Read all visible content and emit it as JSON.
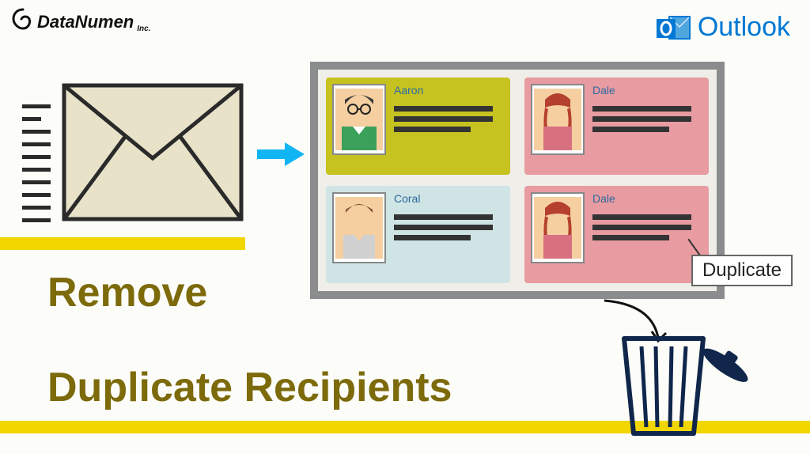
{
  "brand": {
    "company_name": "DataNumen",
    "company_suffix": "Inc."
  },
  "outlook": {
    "product_name": "Outlook"
  },
  "contacts": {
    "card1_name": "Aaron",
    "card2_name": "Dale",
    "card3_name": "Coral",
    "card4_name": "Dale"
  },
  "labels": {
    "duplicate": "Duplicate"
  },
  "headline": {
    "line1": "Remove",
    "line2": "Duplicate Recipients"
  },
  "colors": {
    "outlook_blue": "#0078d4",
    "highlight_yellow": "#f2d600",
    "headline_olive": "#7c6a0b",
    "card_yellow": "#c6c220",
    "card_pink": "#e89ba1",
    "card_lightblue": "#cfe4e4",
    "panel_border": "#8a8c8d",
    "arrow_blue": "#12b5f3"
  }
}
